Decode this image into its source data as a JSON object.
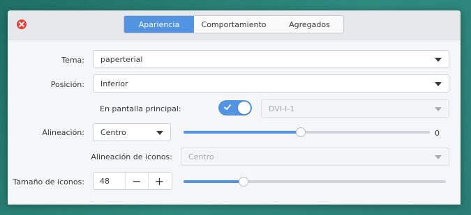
{
  "tabs": [
    {
      "label": "Apariencia",
      "active": true
    },
    {
      "label": "Comportamiento",
      "active": false
    },
    {
      "label": "Agregados",
      "active": false
    }
  ],
  "form": {
    "theme": {
      "label": "Tema:",
      "value": "paperterial"
    },
    "position": {
      "label": "Posición:",
      "value": "Inferior"
    },
    "primary_display": {
      "label": "En pantalla principal:",
      "toggle_on": true,
      "monitor": "DVI-I-1"
    },
    "alignment": {
      "label": "Alineación:",
      "value": "Centro",
      "slider_value": "0",
      "slider_fraction": 0.475
    },
    "icon_alignment": {
      "label": "Alineación de iconos:",
      "value": "Centro"
    },
    "icon_size": {
      "label": "Tamaño de iconos:",
      "value": "48",
      "minus": "−",
      "plus": "+",
      "slider_fraction": 0.23
    }
  },
  "colors": {
    "accent": "#5294e2",
    "close": "#ee3f3f"
  }
}
